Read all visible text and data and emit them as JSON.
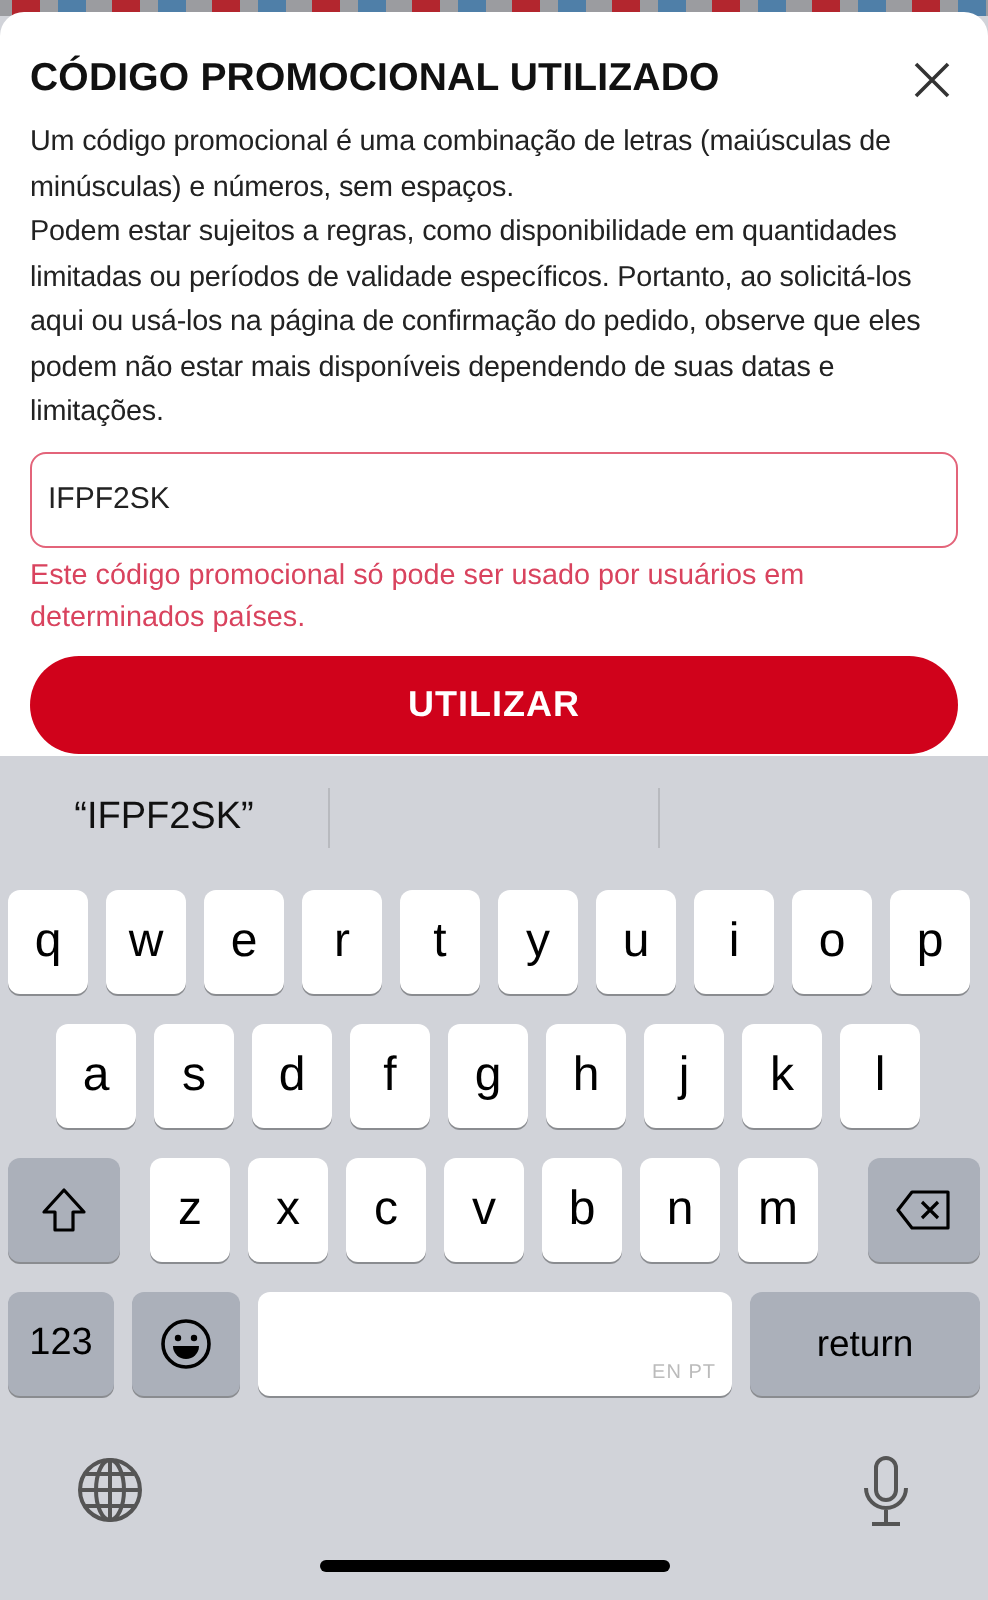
{
  "dialog": {
    "title": "CÓDIGO PROMOCIONAL UTILIZADO",
    "paragraphs": [
      "Um código promocional é uma combinação de letras (maiúsculas de minúsculas) e números, sem espaços.",
      "Podem estar sujeitos a regras, como disponibilidade em quantidades limitadas ou períodos de validade específicos. Portanto, ao solicitá-los aqui ou usá-los na página de confirmação do pedido, observe que eles podem não estar mais disponíveis dependendo de suas datas e limitações."
    ],
    "code_field": {
      "value": "IFPF2SK",
      "invalid": true
    },
    "error": "Este código promocional só pode ser usado por usuários em determinados países.",
    "button": "UTILIZAR"
  },
  "keyboard": {
    "suggestions": [
      "“IFPF2SK”"
    ],
    "rows": [
      {
        "keys": [
          {
            "kind": "letter",
            "label": "q"
          },
          {
            "kind": "letter",
            "label": "w"
          },
          {
            "kind": "letter",
            "label": "e"
          },
          {
            "kind": "letter",
            "label": "r"
          },
          {
            "kind": "letter",
            "label": "t"
          },
          {
            "kind": "letter",
            "label": "y"
          },
          {
            "kind": "letter",
            "label": "u"
          },
          {
            "kind": "letter",
            "label": "i"
          },
          {
            "kind": "letter",
            "label": "o"
          },
          {
            "kind": "letter",
            "label": "p"
          }
        ]
      },
      {
        "keys": [
          {
            "kind": "letter",
            "label": "a"
          },
          {
            "kind": "letter",
            "label": "s"
          },
          {
            "kind": "letter",
            "label": "d"
          },
          {
            "kind": "letter",
            "label": "f"
          },
          {
            "kind": "letter",
            "label": "g"
          },
          {
            "kind": "letter",
            "label": "h"
          },
          {
            "kind": "letter",
            "label": "j"
          },
          {
            "kind": "letter",
            "label": "k"
          },
          {
            "kind": "letter",
            "label": "l"
          }
        ]
      },
      {
        "keys": [
          {
            "kind": "shift"
          },
          {
            "kind": "letter",
            "label": "z"
          },
          {
            "kind": "letter",
            "label": "x"
          },
          {
            "kind": "letter",
            "label": "c"
          },
          {
            "kind": "letter",
            "label": "v"
          },
          {
            "kind": "letter",
            "label": "b"
          },
          {
            "kind": "letter",
            "label": "n"
          },
          {
            "kind": "letter",
            "label": "m"
          },
          {
            "kind": "delete"
          }
        ]
      },
      {
        "keys": [
          {
            "kind": "numbers",
            "label": "123"
          },
          {
            "kind": "emoji"
          },
          {
            "kind": "space",
            "label": "EN PT"
          },
          {
            "kind": "return",
            "label": "return"
          }
        ]
      }
    ]
  }
}
